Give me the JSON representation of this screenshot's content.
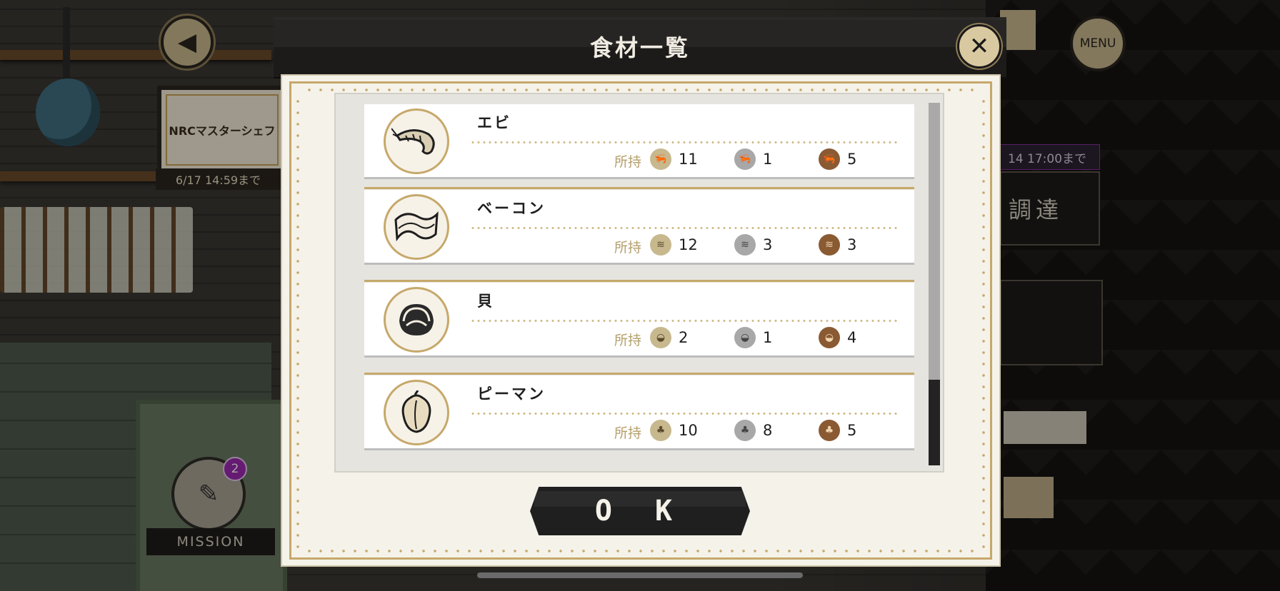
{
  "background": {
    "event_banner": "NRCマスターシェフ",
    "event_date": "6/17 14:59まで",
    "mission_label": "MISSION",
    "mission_badge": "2",
    "menu_label": "MENU",
    "side_date": "14 17:00まで",
    "side_panel_text": "調達"
  },
  "dialog": {
    "title": "食材一覧",
    "ok_label": "O K",
    "owned_label": "所持",
    "items": [
      {
        "name": "エビ",
        "icon": "shrimp-icon",
        "gold": "11",
        "silver": "1",
        "bronze": "5"
      },
      {
        "name": "ベーコン",
        "icon": "bacon-icon",
        "gold": "12",
        "silver": "3",
        "bronze": "3"
      },
      {
        "name": "貝",
        "icon": "clam-icon",
        "gold": "2",
        "silver": "1",
        "bronze": "4"
      },
      {
        "name": "ピーマン",
        "icon": "pepper-icon",
        "gold": "10",
        "silver": "8",
        "bronze": "5"
      }
    ]
  },
  "colors": {
    "gold_accent": "#c6a86a",
    "gold_rank": "#c8b88e",
    "silver_rank": "#a8a8a8",
    "bronze_rank": "#8a5a33",
    "header_bg": "#1c1b1a"
  }
}
